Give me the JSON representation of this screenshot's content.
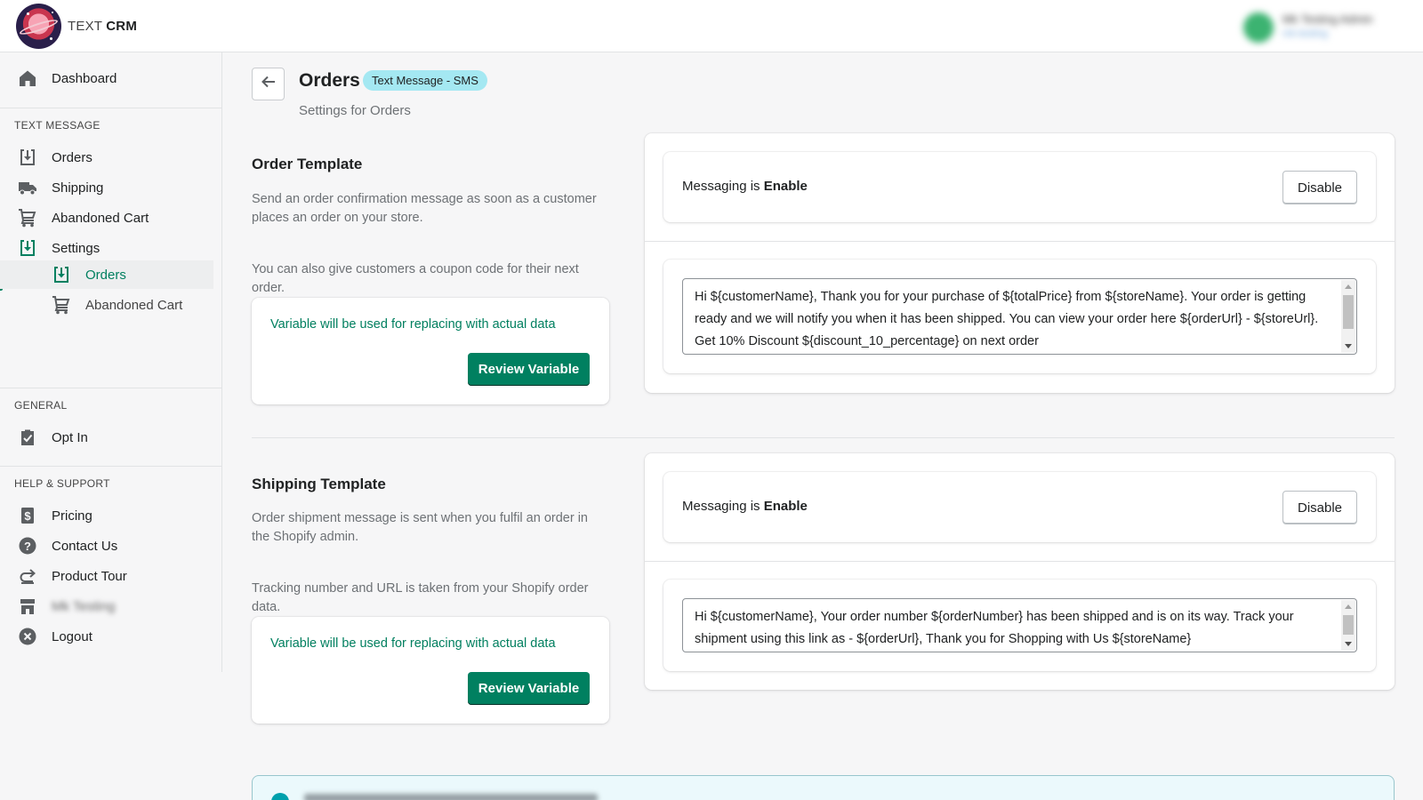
{
  "header": {
    "brand_light": "TEXT",
    "brand_bold": "CRM",
    "user_name": "Mk Testing Admin",
    "user_sub": "mk-testing"
  },
  "sidebar": {
    "dashboard": "Dashboard",
    "section_text_message": "TEXT MESSAGE",
    "orders": "Orders",
    "shipping": "Shipping",
    "abandoned_cart": "Abandoned Cart",
    "settings": "Settings",
    "settings_orders": "Orders",
    "settings_abandoned_cart": "Abandoned Cart",
    "section_general": "GENERAL",
    "opt_in": "Opt In",
    "section_help": "HELP & SUPPORT",
    "pricing": "Pricing",
    "contact_us": "Contact Us",
    "product_tour": "Product Tour",
    "store": "Mk Testing",
    "logout": "Logout"
  },
  "page": {
    "title": "Orders",
    "badge": "Text Message - SMS",
    "subtitle": "Settings for Orders"
  },
  "order_template": {
    "title": "Order Template",
    "desc1": "Send an order confirmation message as soon as a customer places an order on your store.",
    "desc2": "You can also give customers a coupon code for their next order.",
    "variable_text": "Variable will be used for replacing with actual data",
    "review_button": "Review Variable",
    "messaging_prefix": "Messaging is",
    "messaging_status": "Enable",
    "disable_button": "Disable",
    "message": "Hi ${customerName}, Thank you for your purchase of ${totalPrice} from ${storeName}. Your order is getting ready and we will notify you when it has been shipped. You can view your order here ${orderUrl} - ${storeUrl}. Get 10% Discount ${discount_10_percentage} on next order"
  },
  "shipping_template": {
    "title": "Shipping Template",
    "desc1": "Order shipment message is sent when you fulfil an order in the Shopify admin.",
    "desc2": "Tracking number and URL is taken from your Shopify order data.",
    "variable_text": "Variable will be used for replacing with actual data",
    "review_button": "Review Variable",
    "messaging_prefix": "Messaging is",
    "messaging_status": "Enable",
    "disable_button": "Disable",
    "message": "Hi ${customerName}, Your order number ${orderNumber} has been shipped and is on its way. Track your shipment using this link as - ${orderUrl}, Thank you for Shopping with Us ${storeName}"
  },
  "icons": [
    "home-icon",
    "inbox-download-icon",
    "truck-icon",
    "cart-icon",
    "settings-download-icon",
    "clipboard-check-icon",
    "dollar-icon",
    "question-icon",
    "redo-icon",
    "store-icon",
    "close-circle-icon",
    "arrow-left-icon",
    "info-icon"
  ],
  "colors": {
    "primary": "#008060",
    "active_text": "#007f5f",
    "badge_bg": "#a4e8f2",
    "icon": "#5c5f62"
  }
}
